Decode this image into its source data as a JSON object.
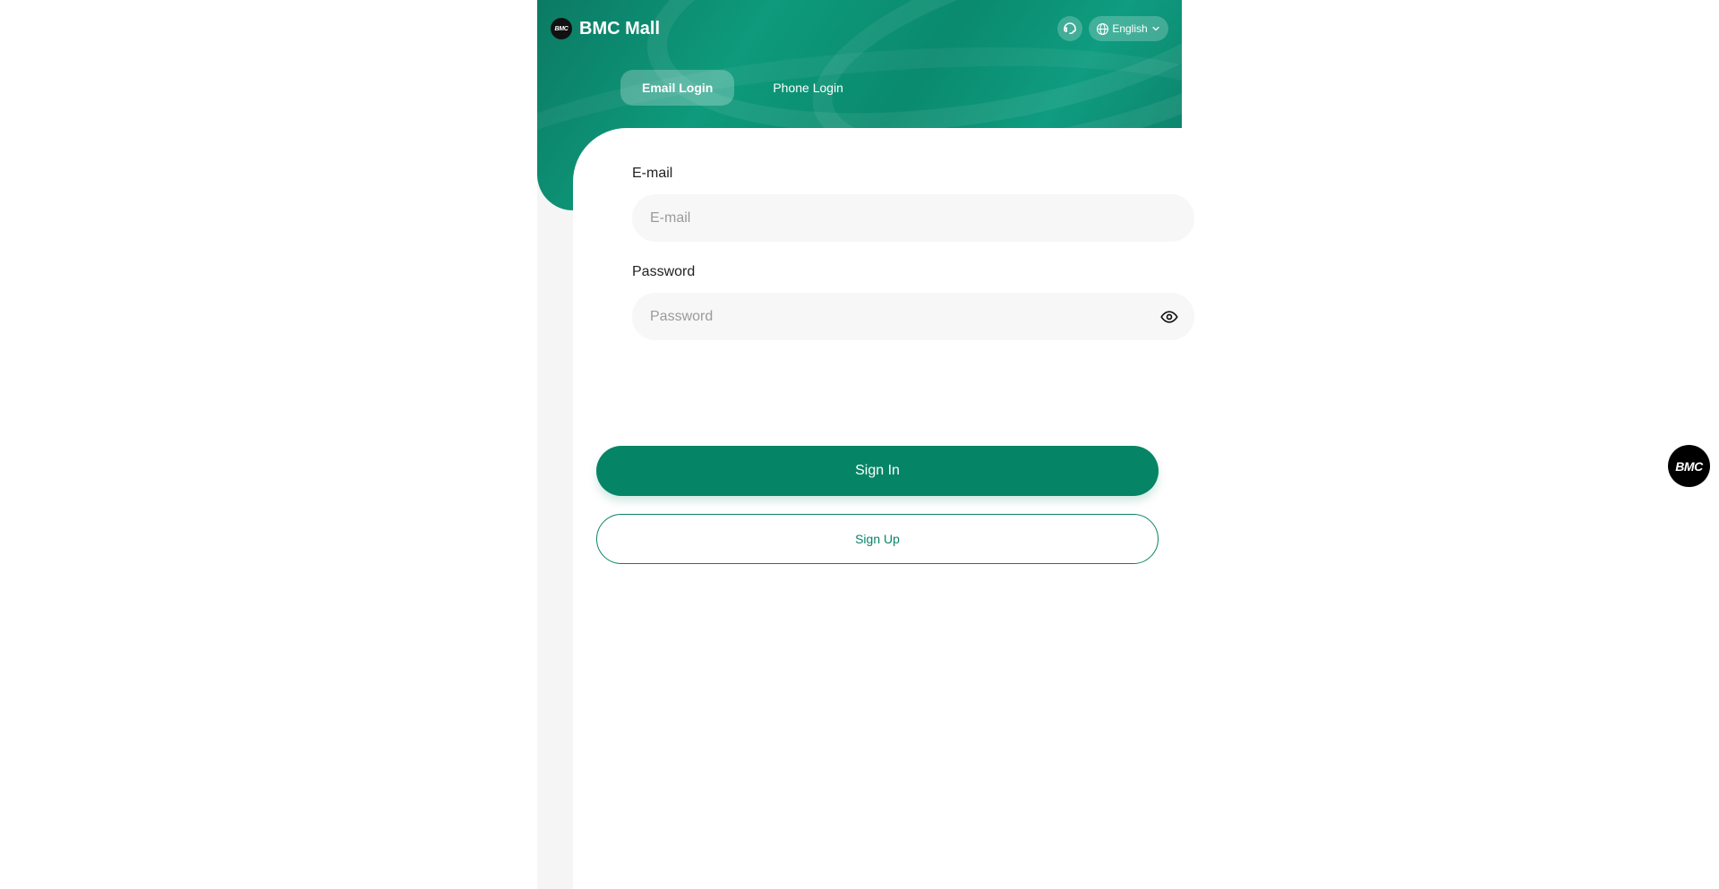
{
  "header": {
    "brand_logo_text": "BMC",
    "brand_name": "BMC Mall",
    "support_icon": "headset-icon",
    "language": {
      "icon": "globe-icon",
      "label": "English",
      "chevron_icon": "chevron-down-icon"
    }
  },
  "tabs": [
    {
      "label": "Email Login",
      "active": true
    },
    {
      "label": "Phone Login",
      "active": false
    }
  ],
  "form": {
    "email": {
      "label": "E-mail",
      "placeholder": "E-mail",
      "value": ""
    },
    "password": {
      "label": "Password",
      "placeholder": "Password",
      "value": "",
      "toggle_icon": "eye-icon"
    }
  },
  "buttons": {
    "sign_in": "Sign In",
    "sign_up": "Sign Up"
  },
  "floating": {
    "logo_text": "BMC"
  },
  "colors": {
    "accent": "#068466",
    "hero_gradient": [
      "#0b7a63",
      "#0e9a7c"
    ],
    "page_background": "#f5f5f5",
    "input_background": "#f7f7f7"
  }
}
